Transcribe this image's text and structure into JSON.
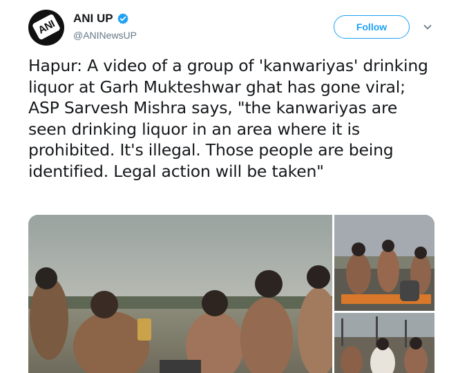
{
  "tweet": {
    "display_name": "ANI UP",
    "handle": "@ANINewsUP",
    "avatar_text": "ANI",
    "verified": true,
    "follow_label": "Follow",
    "text": "Hapur: A video of a group of 'kanwariyas' drinking liquor at Garh Mukteshwar ghat has gone viral; ASP Sarvesh Mishra says, \"the kanwariyas are seen drinking liquor in an area where it is prohibited. It's illegal. Those people are being identified. Legal action will be taken\""
  },
  "colors": {
    "accent": "#1da1f2",
    "text": "#14171a",
    "secondary_text": "#657786"
  },
  "icons": {
    "verified": "verified-badge-icon",
    "menu": "chevron-down-icon"
  }
}
